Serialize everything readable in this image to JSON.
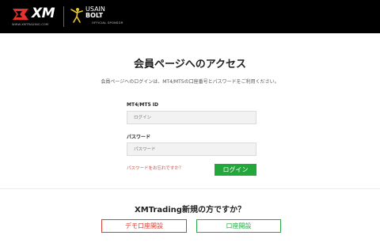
{
  "header": {
    "logo_text": "XM",
    "logo_url": "WWW.XMTRADING.COM",
    "sponsor_name_line1": "USAIN",
    "sponsor_name_line2": "BOLT",
    "sponsor_sub": "OFFICIAL SPONSOR"
  },
  "main": {
    "title": "会員ページへのアクセス",
    "intro": "会員ページへのログインは、MT4/MT5の口座番号とパスワードをご利用ください。",
    "id_label": "MT4/MT5 ID",
    "id_placeholder": "ログイン",
    "password_label": "パスワード",
    "password_placeholder": "パスワード",
    "forgot_link": "パスワードをお忘れですか？",
    "login_button": "ログイン"
  },
  "signup": {
    "question": "XMTrading新規の方ですか？",
    "demo_button": "デモ口座開設",
    "open_button": "口座開設"
  },
  "colors": {
    "header_bg": "#000000",
    "brand_red": "#d93f33",
    "brand_green": "#22a73b"
  }
}
